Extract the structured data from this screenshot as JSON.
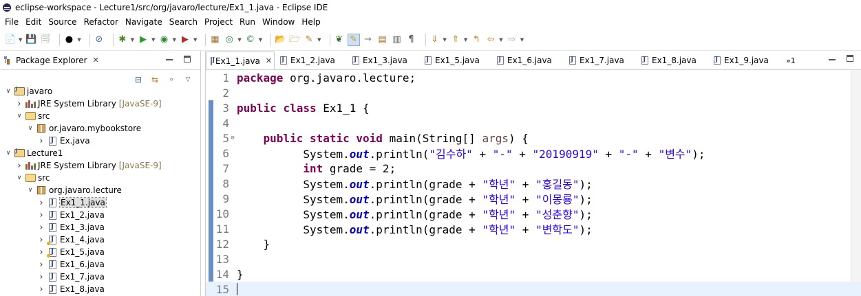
{
  "window": {
    "title": "eclipse-workspace - Lecture1/src/org/javaro/lecture/Ex1_1.java - Eclipse IDE"
  },
  "menu": [
    "File",
    "Edit",
    "Source",
    "Refactor",
    "Navigate",
    "Search",
    "Project",
    "Run",
    "Window",
    "Help"
  ],
  "package_explorer": {
    "title": "Package Explorer",
    "tree": [
      {
        "depth": 0,
        "twisty": "open",
        "icon": "project",
        "label": "javaro",
        "deco": ""
      },
      {
        "depth": 1,
        "twisty": "closed",
        "icon": "library",
        "label": "JRE System Library",
        "deco": "[JavaSE-9]"
      },
      {
        "depth": 1,
        "twisty": "open",
        "icon": "src-folder",
        "label": "src",
        "deco": ""
      },
      {
        "depth": 2,
        "twisty": "open",
        "icon": "package",
        "label": "or.javaro.mybookstore",
        "deco": ""
      },
      {
        "depth": 3,
        "twisty": "closed",
        "icon": "java-file",
        "label": "Ex.java",
        "deco": ""
      },
      {
        "depth": 0,
        "twisty": "open",
        "icon": "project",
        "label": "Lecture1",
        "deco": ""
      },
      {
        "depth": 1,
        "twisty": "closed",
        "icon": "library",
        "label": "JRE System Library",
        "deco": "[JavaSE-9]"
      },
      {
        "depth": 1,
        "twisty": "open",
        "icon": "src-folder",
        "label": "src",
        "deco": ""
      },
      {
        "depth": 2,
        "twisty": "open",
        "icon": "package",
        "label": "org.javaro.lecture",
        "deco": ""
      },
      {
        "depth": 3,
        "twisty": "closed",
        "icon": "java-file",
        "label": "Ex1_1.java",
        "deco": "",
        "selected": true
      },
      {
        "depth": 3,
        "twisty": "closed",
        "icon": "java-file",
        "label": "Ex1_2.java",
        "deco": ""
      },
      {
        "depth": 3,
        "twisty": "closed",
        "icon": "java-file",
        "label": "Ex1_3.java",
        "deco": ""
      },
      {
        "depth": 3,
        "twisty": "closed",
        "icon": "java-file-warn",
        "label": "Ex1_4.java",
        "deco": ""
      },
      {
        "depth": 3,
        "twisty": "closed",
        "icon": "java-file-warn",
        "label": "Ex1_5.java",
        "deco": ""
      },
      {
        "depth": 3,
        "twisty": "closed",
        "icon": "java-file",
        "label": "Ex1_6.java",
        "deco": ""
      },
      {
        "depth": 3,
        "twisty": "closed",
        "icon": "java-file",
        "label": "Ex1_7.java",
        "deco": ""
      },
      {
        "depth": 3,
        "twisty": "closed",
        "icon": "java-file",
        "label": "Ex1_8.java",
        "deco": ""
      }
    ]
  },
  "editor": {
    "tabs": [
      {
        "label": "Ex1_1.java",
        "active": true
      },
      {
        "label": "Ex1_2.java",
        "active": false
      },
      {
        "label": "Ex1_3.java",
        "active": false
      },
      {
        "label": "Ex1_5.java",
        "active": false
      },
      {
        "label": "Ex1_6.java",
        "active": false
      },
      {
        "label": "Ex1_7.java",
        "active": false
      },
      {
        "label": "Ex1_8.java",
        "active": false
      },
      {
        "label": "Ex1_9.java",
        "active": false
      }
    ],
    "overflow_label": "»1",
    "current_line": 15,
    "lines": [
      {
        "n": "1",
        "tokens": [
          [
            "kw",
            "package"
          ],
          [
            "t",
            " org.javaro.lecture;"
          ]
        ]
      },
      {
        "n": "2",
        "tokens": []
      },
      {
        "n": "3",
        "tokens": [
          [
            "kw",
            "public"
          ],
          [
            "t",
            " "
          ],
          [
            "kw",
            "class"
          ],
          [
            "t",
            " Ex1_1 {"
          ]
        ]
      },
      {
        "n": "4",
        "tokens": []
      },
      {
        "n": "5",
        "fold": "⊖",
        "tokens": [
          [
            "t",
            "    "
          ],
          [
            "kw",
            "public"
          ],
          [
            "t",
            " "
          ],
          [
            "kw",
            "static"
          ],
          [
            "t",
            " "
          ],
          [
            "kw",
            "void"
          ],
          [
            "t",
            " main(String[] "
          ],
          [
            "prm",
            "args"
          ],
          [
            "t",
            ") {"
          ]
        ]
      },
      {
        "n": "6",
        "tokens": [
          [
            "t",
            "          System."
          ],
          [
            "fld",
            "out"
          ],
          [
            "t",
            ".println("
          ],
          [
            "str",
            "\"김수하\""
          ],
          [
            "t",
            " + "
          ],
          [
            "str",
            "\"-\""
          ],
          [
            "t",
            " + "
          ],
          [
            "str",
            "\"20190919\""
          ],
          [
            "t",
            " + "
          ],
          [
            "str",
            "\"-\""
          ],
          [
            "t",
            " + "
          ],
          [
            "str",
            "\"변수\""
          ],
          [
            "t",
            ");"
          ]
        ]
      },
      {
        "n": "7",
        "tokens": [
          [
            "t",
            "          "
          ],
          [
            "kw",
            "int"
          ],
          [
            "t",
            " grade = 2;"
          ]
        ]
      },
      {
        "n": "8",
        "tokens": [
          [
            "t",
            "          System."
          ],
          [
            "fld",
            "out"
          ],
          [
            "t",
            ".println(grade + "
          ],
          [
            "str",
            "\"학년\""
          ],
          [
            "t",
            " + "
          ],
          [
            "str",
            "\"홍길동\""
          ],
          [
            "t",
            ");"
          ]
        ]
      },
      {
        "n": "9",
        "tokens": [
          [
            "t",
            "          System."
          ],
          [
            "fld",
            "out"
          ],
          [
            "t",
            ".println(grade + "
          ],
          [
            "str",
            "\"학년\""
          ],
          [
            "t",
            " + "
          ],
          [
            "str",
            "\"이몽룡\""
          ],
          [
            "t",
            ");"
          ]
        ]
      },
      {
        "n": "10",
        "tokens": [
          [
            "t",
            "          System."
          ],
          [
            "fld",
            "out"
          ],
          [
            "t",
            ".println(grade + "
          ],
          [
            "str",
            "\"학년\""
          ],
          [
            "t",
            " + "
          ],
          [
            "str",
            "\"성춘향\""
          ],
          [
            "t",
            ");"
          ]
        ]
      },
      {
        "n": "11",
        "tokens": [
          [
            "t",
            "          System."
          ],
          [
            "fld",
            "out"
          ],
          [
            "t",
            ".println(grade + "
          ],
          [
            "str",
            "\"학년\""
          ],
          [
            "t",
            " + "
          ],
          [
            "str",
            "\"변학도\""
          ],
          [
            "t",
            ");"
          ]
        ]
      },
      {
        "n": "12",
        "tokens": [
          [
            "t",
            "    }"
          ]
        ]
      },
      {
        "n": "13",
        "tokens": []
      },
      {
        "n": "14",
        "tokens": [
          [
            "t",
            "}"
          ]
        ]
      },
      {
        "n": "15",
        "tokens": []
      }
    ]
  },
  "colors": {
    "keyword": "#7f0055",
    "string": "#2a00ff",
    "field": "#0000c0",
    "current_line": "#e8f2fe",
    "gutter_mark": "#6a8fc4"
  },
  "toolbar_icons": [
    "new-icon",
    "save-icon",
    "save-all-icon",
    "profile-icon",
    "skip-breakpoints-icon",
    "debug-icon",
    "run-icon",
    "coverage-icon",
    "external-tools-icon",
    "new-java-project-icon",
    "new-package-icon",
    "new-class-icon",
    "open-type-icon",
    "open-task-icon",
    "search-icon",
    "mark-occurrences-icon",
    "highlight-icon",
    "toggle-block-selection-icon",
    "show-whitespace-icon",
    "pilcrow-icon",
    "next-annotation-icon",
    "previous-annotation-icon",
    "last-edit-icon",
    "back-icon",
    "forward-icon"
  ]
}
